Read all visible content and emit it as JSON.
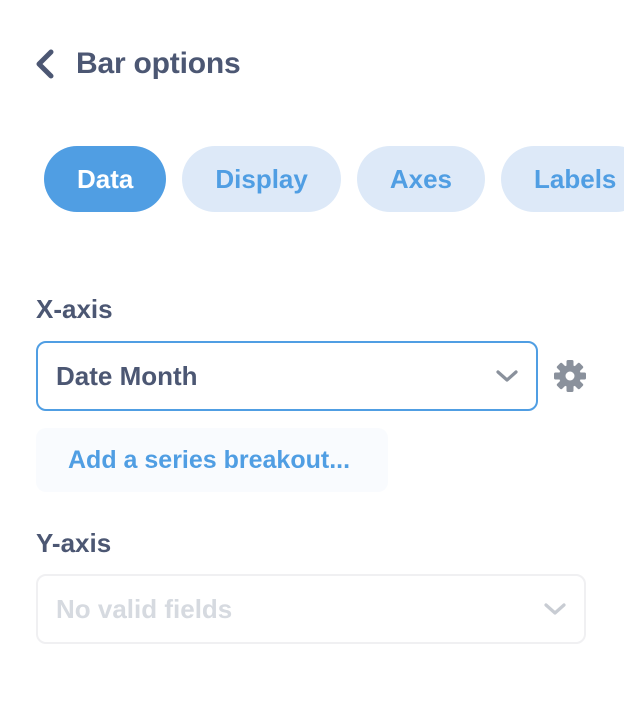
{
  "header": {
    "title": "Bar options",
    "back_icon": "chevron-left-icon"
  },
  "tabs": [
    {
      "label": "Data",
      "active": true
    },
    {
      "label": "Display",
      "active": false
    },
    {
      "label": "Axes",
      "active": false
    },
    {
      "label": "Labels",
      "active": false
    }
  ],
  "x_axis": {
    "label": "X-axis",
    "selected": "Date Month",
    "settings_icon": "gear-icon",
    "add_breakout_label": "Add a series breakout..."
  },
  "y_axis": {
    "label": "Y-axis",
    "placeholder": "No valid fields"
  },
  "colors": {
    "accent": "#509ee3",
    "accent_light": "#dde9f8",
    "text_dark": "#4c5773",
    "text_disabled": "#d6dae0",
    "icon_gray": "#8a919c"
  }
}
